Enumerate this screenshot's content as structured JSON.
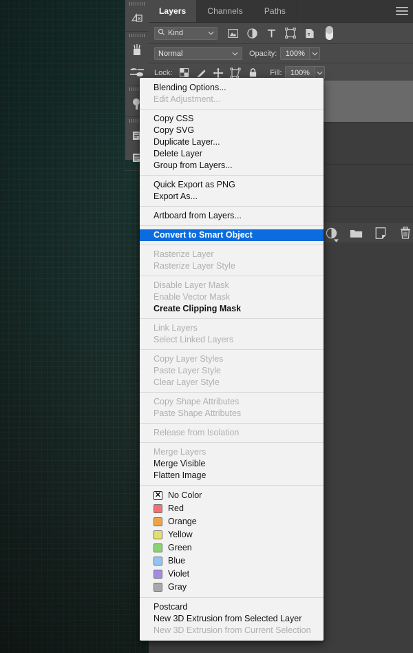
{
  "colors": {
    "menu_bg": "#f2f2f2",
    "highlight": "#0a6cde",
    "panel_bg": "#3d3d3d",
    "toolbar_bg": "#4a4a4a",
    "canvas": "#1b2d29"
  },
  "dock": {
    "items": [
      {
        "name": "adjustments-panel-icon"
      },
      {
        "name": "brushes-panel-icon"
      },
      {
        "name": "brush-presets-panel-icon"
      },
      {
        "name": "styles-panel-icon"
      },
      {
        "name": "paragraph-panel-icon"
      },
      {
        "name": "character-panel-icon"
      }
    ]
  },
  "panel": {
    "tabs": [
      {
        "label": "Layers",
        "active": true
      },
      {
        "label": "Channels",
        "active": false
      },
      {
        "label": "Paths",
        "active": false
      }
    ],
    "menu_icon": "hamburger-icon",
    "filter": {
      "search_icon": "search-icon",
      "kind_value": "Kind",
      "chevron": "chevron-down-icon",
      "icons": [
        "pixel-layer-filter-icon",
        "adjustment-layer-filter-icon",
        "type-layer-filter-icon",
        "shape-layer-filter-icon",
        "smart-object-filter-icon",
        "filter-toggle-switch-icon"
      ]
    },
    "blend": {
      "mode_value": "Normal",
      "opacity_label": "Opacity:",
      "opacity_value": "100%"
    },
    "lock": {
      "label": "Lock:",
      "icons": [
        "lock-transparent-pixels-icon",
        "lock-image-pixels-icon",
        "lock-position-icon",
        "lock-artboard-nesting-icon",
        "lock-all-icon"
      ],
      "fill_label": "Fill:",
      "fill_value": "100%"
    },
    "footer_buttons": [
      "add-layer-style-icon",
      "new-group-icon",
      "new-layer-icon",
      "delete-layer-icon"
    ]
  },
  "context_menu": {
    "groups": [
      {
        "items": [
          {
            "label": "Blending Options...",
            "state": "normal"
          },
          {
            "label": "Edit Adjustment...",
            "state": "disabled"
          }
        ]
      },
      {
        "items": [
          {
            "label": "Copy CSS",
            "state": "normal"
          },
          {
            "label": "Copy SVG",
            "state": "normal"
          },
          {
            "label": "Duplicate Layer...",
            "state": "normal"
          },
          {
            "label": "Delete Layer",
            "state": "normal"
          },
          {
            "label": "Group from Layers...",
            "state": "normal"
          }
        ]
      },
      {
        "items": [
          {
            "label": "Quick Export as PNG",
            "state": "normal"
          },
          {
            "label": "Export As...",
            "state": "normal"
          }
        ]
      },
      {
        "items": [
          {
            "label": "Artboard from Layers...",
            "state": "normal"
          }
        ]
      },
      {
        "items": [
          {
            "label": "Convert to Smart Object",
            "state": "highlight"
          }
        ]
      },
      {
        "items": [
          {
            "label": "Rasterize Layer",
            "state": "disabled"
          },
          {
            "label": "Rasterize Layer Style",
            "state": "disabled"
          }
        ]
      },
      {
        "items": [
          {
            "label": "Disable Layer Mask",
            "state": "disabled"
          },
          {
            "label": "Enable Vector Mask",
            "state": "disabled"
          },
          {
            "label": "Create Clipping Mask",
            "state": "bold"
          }
        ]
      },
      {
        "items": [
          {
            "label": "Link Layers",
            "state": "disabled"
          },
          {
            "label": "Select Linked Layers",
            "state": "disabled"
          }
        ]
      },
      {
        "items": [
          {
            "label": "Copy Layer Styles",
            "state": "disabled"
          },
          {
            "label": "Paste Layer Style",
            "state": "disabled"
          },
          {
            "label": "Clear Layer Style",
            "state": "disabled"
          }
        ]
      },
      {
        "items": [
          {
            "label": "Copy Shape Attributes",
            "state": "disabled"
          },
          {
            "label": "Paste Shape Attributes",
            "state": "disabled"
          }
        ]
      },
      {
        "items": [
          {
            "label": "Release from Isolation",
            "state": "disabled"
          }
        ]
      },
      {
        "items": [
          {
            "label": "Merge Layers",
            "state": "disabled"
          },
          {
            "label": "Merge Visible",
            "state": "normal"
          },
          {
            "label": "Flatten Image",
            "state": "normal"
          }
        ]
      },
      {
        "type": "colors",
        "items": [
          {
            "label": "No Color",
            "state": "normal",
            "swatch": "none",
            "glyph": "✕"
          },
          {
            "label": "Red",
            "state": "normal",
            "swatch": "#ef7272"
          },
          {
            "label": "Orange",
            "state": "normal",
            "swatch": "#efa349"
          },
          {
            "label": "Yellow",
            "state": "normal",
            "swatch": "#e1df6e"
          },
          {
            "label": "Green",
            "state": "normal",
            "swatch": "#86d473"
          },
          {
            "label": "Blue",
            "state": "normal",
            "swatch": "#8fc4f4"
          },
          {
            "label": "Violet",
            "state": "normal",
            "swatch": "#a48ae3"
          },
          {
            "label": "Gray",
            "state": "normal",
            "swatch": "#a8a8a8"
          }
        ]
      },
      {
        "items": [
          {
            "label": "Postcard",
            "state": "normal"
          },
          {
            "label": "New 3D Extrusion from Selected Layer",
            "state": "normal"
          },
          {
            "label": "New 3D Extrusion from Current Selection",
            "state": "disabled"
          }
        ]
      }
    ]
  }
}
